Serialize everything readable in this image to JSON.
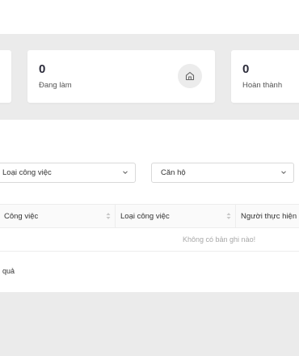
{
  "stats": [
    {
      "count": "0",
      "label": "Đang làm",
      "icon": "home-icon"
    },
    {
      "count": "0",
      "label": "Hoàn thành"
    }
  ],
  "filters": {
    "task_type": {
      "value": "Loại công việc"
    },
    "apartment": {
      "value": "Căn hộ"
    }
  },
  "table": {
    "columns": [
      "Công việc",
      "Loại công việc",
      "Người thực hiện"
    ],
    "empty_text": "Không có bản ghi nào!"
  },
  "footer": {
    "result_text": "quả"
  }
}
